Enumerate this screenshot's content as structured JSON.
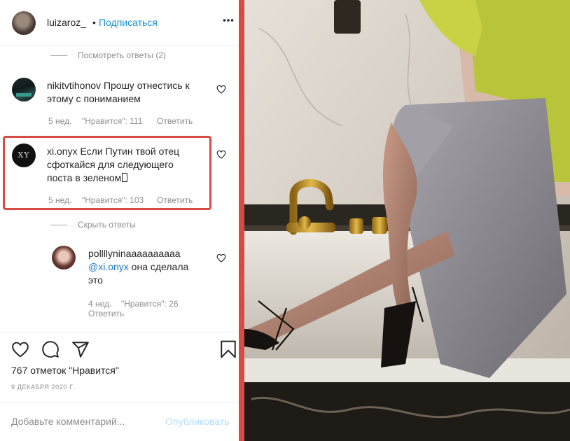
{
  "header": {
    "username": "luizaroz_",
    "dot": "•",
    "follow_label": "Подписаться"
  },
  "thread": {
    "view_replies_label": "Посмотреть ответы (2)",
    "hide_replies_label": "Скрыть ответы"
  },
  "comments": [
    {
      "username": "nikitvtihonov",
      "text_line1": "Прошу отнестись к",
      "text_line2": "этому с пониманием",
      "age": "5 нед.",
      "likes": "\"Нравится\": 111",
      "reply_label": "Ответить"
    },
    {
      "username": "xi.onyx",
      "text_line1": "Если Путин твой отец",
      "text_line2": "сфоткайся для следующего",
      "text_line3": "поста в зеленом",
      "avatar_text": "XY",
      "age": "5 нед.",
      "likes": "\"Нравится\": 103",
      "reply_label": "Ответить"
    }
  ],
  "reply": {
    "username": "pollllyninaaaaaaaaaa",
    "mention": "@xi.onyx",
    "text_line1": " она сделала",
    "text_line2": "это",
    "age": "4 нед.",
    "likes": "\"Нравится\": 26",
    "reply_label": "Ответить"
  },
  "post": {
    "likes_count": "767 отметок \"Нравится\"",
    "date": "9 ДЕКАБРЯ 2020 Г.",
    "comment_placeholder": "Добавьте комментарий...",
    "publish_label": "Опубликовать"
  },
  "colors": {
    "accent_blue": "#1a92d6",
    "highlight_red": "#d84a44",
    "muted": "#8e8e8e"
  },
  "icons": [
    "more-icon",
    "heart-icon",
    "comment-icon",
    "share-icon",
    "bookmark-icon"
  ]
}
